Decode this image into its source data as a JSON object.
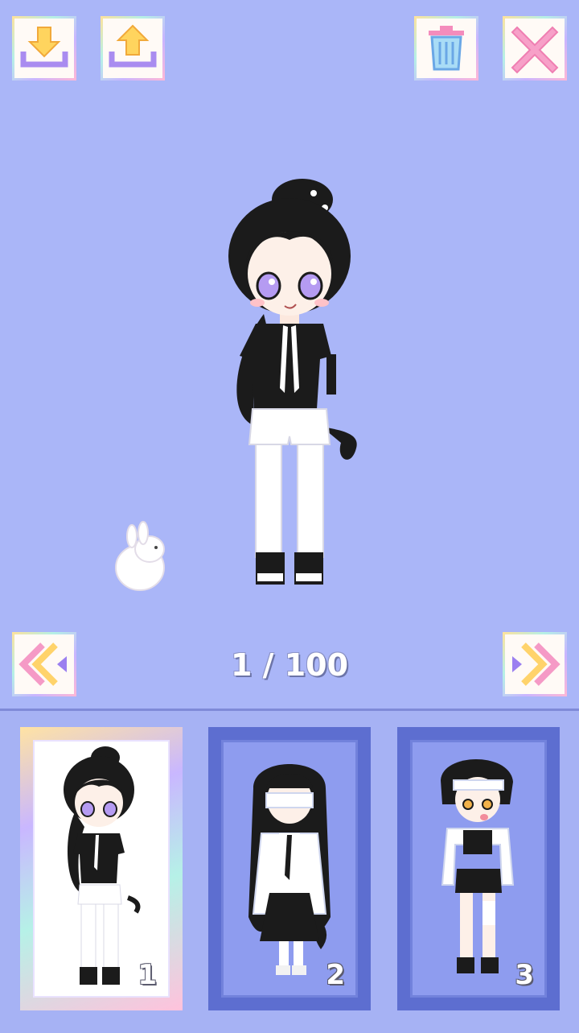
{
  "toolbar": {
    "download_icon": "download-arrow-icon",
    "upload_icon": "upload-arrow-icon",
    "trash_icon": "trash-can-icon",
    "close_icon": "close-x-icon"
  },
  "navigation": {
    "prev_icon": "double-chevron-left-icon",
    "next_icon": "double-chevron-right-icon",
    "counter": "1 / 100"
  },
  "slots": [
    {
      "number": "1",
      "selected": true
    },
    {
      "number": "2",
      "selected": false
    },
    {
      "number": "3",
      "selected": false
    }
  ],
  "colors": {
    "background": "#aab6f8",
    "slot_frame": "#5d6ed0",
    "accent_pink": "#f28cc0",
    "accent_yellow": "#ffd15c",
    "accent_purple": "#9b7ff0"
  }
}
